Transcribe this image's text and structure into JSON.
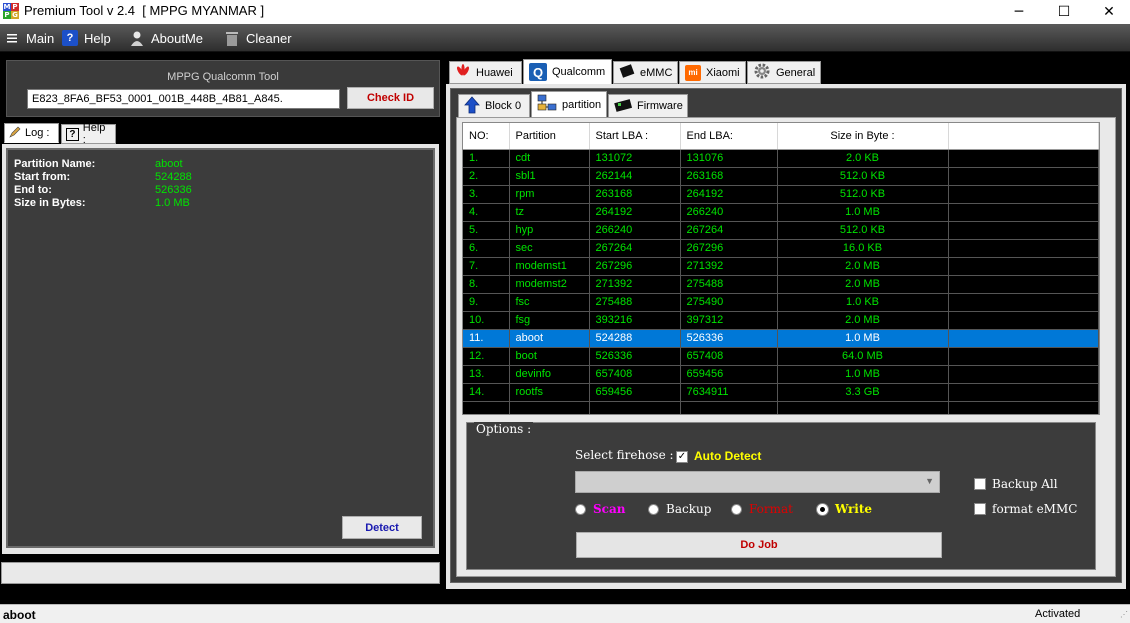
{
  "window": {
    "title": "Premium Tool v 2.4  [ MPPG MYANMAR ]",
    "icon_letters": [
      "M",
      "P",
      "P",
      "G"
    ],
    "minimize": "─",
    "maximize": "☐",
    "close": "✕"
  },
  "menu": {
    "items": [
      {
        "label": "Main",
        "icon": "menu-lines-icon"
      },
      {
        "label": "Help",
        "icon": "help-icon"
      },
      {
        "label": "AboutMe",
        "icon": "person-icon"
      },
      {
        "label": "Cleaner",
        "icon": "trash-icon"
      }
    ]
  },
  "left": {
    "caption": "MPPG Qualcomm Tool",
    "device_id": "E823_8FA6_BF53_0001_001B_448B_4B81_A845.",
    "check_id_label": "Check ID",
    "tabs": [
      {
        "label": "Log :",
        "icon": "pencil-icon",
        "active": true
      },
      {
        "label": "Help :",
        "icon": "help-icon",
        "active": false
      }
    ],
    "log": {
      "rows": [
        {
          "label": "Partition Name:",
          "value": "aboot"
        },
        {
          "label": "Start from:",
          "value": "524288"
        },
        {
          "label": "End to:",
          "value": "526336"
        },
        {
          "label": "Size in Bytes:",
          "value": "1.0 MB"
        }
      ]
    },
    "detect_label": "Detect"
  },
  "right": {
    "tabs": [
      {
        "label": "Huawei",
        "icon": "huawei-icon"
      },
      {
        "label": "Qualcomm",
        "icon": "qualcomm-icon"
      },
      {
        "label": "eMMC",
        "icon": "chip-icon"
      },
      {
        "label": "Xiaomi",
        "icon": "xiaomi-icon"
      },
      {
        "label": "General",
        "icon": "gear-icon"
      }
    ],
    "subtabs": [
      {
        "label": "Block 0",
        "icon": "upload-arrow-icon"
      },
      {
        "label": "partition",
        "icon": "network-icon"
      },
      {
        "label": "Firmware",
        "icon": "firmware-icon"
      }
    ],
    "table": {
      "columns": [
        "NO:",
        "Partition",
        "Start LBA :",
        "End LBA:",
        "Size in Byte :",
        ""
      ],
      "rows": [
        [
          "1.",
          "cdt",
          "131072",
          "131076",
          "2.0 KB"
        ],
        [
          "2.",
          "sbl1",
          "262144",
          "263168",
          "512.0 KB"
        ],
        [
          "3.",
          "rpm",
          "263168",
          "264192",
          "512.0 KB"
        ],
        [
          "4.",
          "tz",
          "264192",
          "266240",
          "1.0 MB"
        ],
        [
          "5.",
          "hyp",
          "266240",
          "267264",
          "512.0 KB"
        ],
        [
          "6.",
          "sec",
          "267264",
          "267296",
          "16.0 KB"
        ],
        [
          "7.",
          "modemst1",
          "267296",
          "271392",
          "2.0 MB"
        ],
        [
          "8.",
          "modemst2",
          "271392",
          "275488",
          "2.0 MB"
        ],
        [
          "9.",
          "fsc",
          "275488",
          "275490",
          "1.0 KB"
        ],
        [
          "10.",
          "fsg",
          "393216",
          "397312",
          "2.0 MB"
        ],
        [
          "11.",
          "aboot",
          "524288",
          "526336",
          "1.0 MB"
        ],
        [
          "12.",
          "boot",
          "526336",
          "657408",
          "64.0 MB"
        ],
        [
          "13.",
          "devinfo",
          "657408",
          "659456",
          "1.0 MB"
        ],
        [
          "14.",
          "rootfs",
          "659456",
          "7634911",
          "3.3 GB"
        ]
      ],
      "selected_row": 10
    },
    "options": {
      "legend": "Options :",
      "select_firehose_label": "Select firehose :",
      "auto_detect_label": "Auto Detect",
      "auto_detect_checked": "✓",
      "radios": [
        {
          "label": "Scan",
          "color": "#ff00ff",
          "selected": false
        },
        {
          "label": "Backup",
          "color": "#ffffff",
          "selected": false
        },
        {
          "label": "Format",
          "color": "#e00000",
          "selected": false
        },
        {
          "label": "Write",
          "color": "#ffff00",
          "selected": true
        }
      ],
      "backup_all_label": "Backup All",
      "format_emmc_label": "format eMMC",
      "do_job_label": "Do Job"
    }
  },
  "status": {
    "left": "aboot",
    "right": "Activated"
  }
}
